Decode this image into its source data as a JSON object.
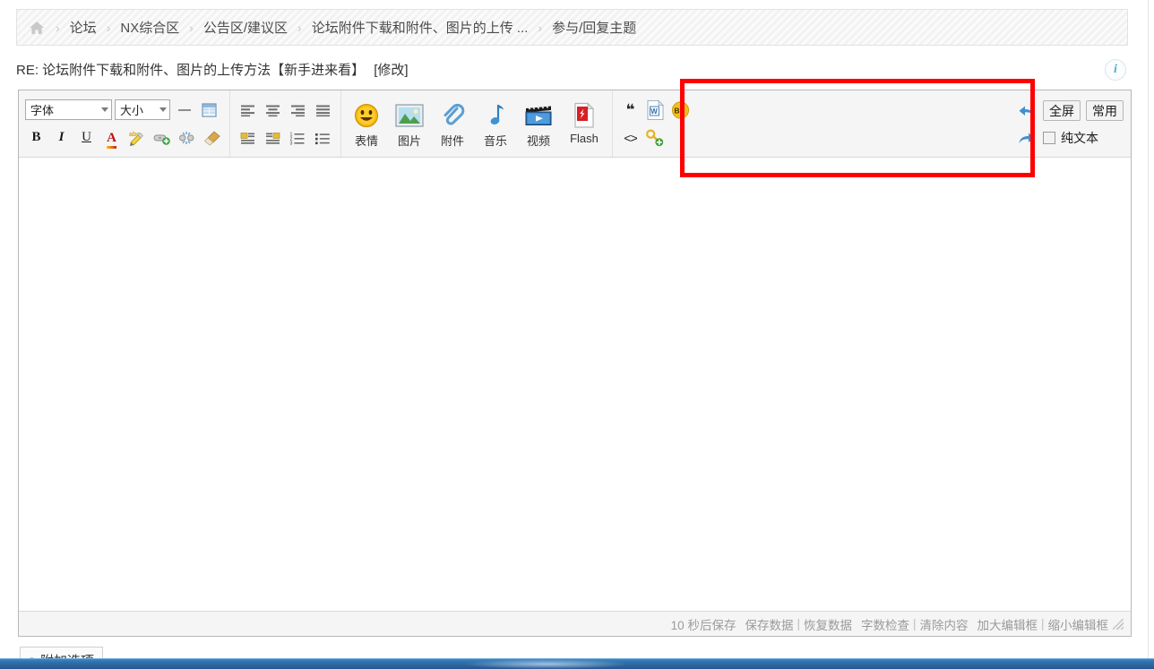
{
  "breadcrumb": {
    "home_icon": "home-icon",
    "separator": "›",
    "items": [
      {
        "label": "论坛"
      },
      {
        "label": "NX综合区"
      },
      {
        "label": "公告区/建议区"
      },
      {
        "label": "论坛附件下载和附件、图片的上传 ..."
      },
      {
        "label": "参与/回复主题"
      }
    ]
  },
  "header": {
    "title": "RE: 论坛附件下载和附件、图片的上传方法【新手进来看】",
    "edit_link": "[修改]",
    "info_icon": "info-icon",
    "info_glyph": "i"
  },
  "toolbar": {
    "font_select": {
      "value": "字体",
      "icon": "chevron-down-icon"
    },
    "size_select": {
      "value": "大小",
      "icon": "chevron-down-icon"
    },
    "row1_misc": [
      {
        "name": "horizontal-rule-button",
        "icon": "horizontal-rule-icon"
      },
      {
        "name": "insert-table-button",
        "icon": "table-icon"
      }
    ],
    "format_buttons": [
      {
        "name": "bold-button",
        "glyph": "B",
        "icon": "bold-icon"
      },
      {
        "name": "italic-button",
        "glyph": "I",
        "icon": "italic-icon"
      },
      {
        "name": "underline-button",
        "glyph": "U",
        "icon": "underline-icon"
      },
      {
        "name": "text-color-button",
        "glyph": "A",
        "icon": "text-color-icon"
      },
      {
        "name": "spellcheck-button",
        "glyph": "abc",
        "icon": "spellcheck-icon"
      },
      {
        "name": "insert-link-button",
        "glyph": "",
        "icon": "link-add-icon"
      },
      {
        "name": "remove-link-button",
        "glyph": "",
        "icon": "link-break-icon"
      },
      {
        "name": "clear-format-button",
        "glyph": "",
        "icon": "broom-icon"
      }
    ],
    "align_buttons": [
      {
        "name": "align-left-button",
        "icon": "align-left-icon"
      },
      {
        "name": "align-center-button",
        "icon": "align-center-icon"
      },
      {
        "name": "align-right-button",
        "icon": "align-right-icon"
      },
      {
        "name": "align-justify-button",
        "icon": "align-justify-icon"
      },
      {
        "name": "float-left-button",
        "icon": "image-float-left-icon"
      },
      {
        "name": "float-right-button",
        "icon": "image-float-right-icon"
      },
      {
        "name": "ordered-list-button",
        "icon": "ordered-list-icon"
      },
      {
        "name": "unordered-list-button",
        "icon": "unordered-list-icon"
      }
    ],
    "media_buttons": [
      {
        "label": "表情",
        "icon": "smiley-icon",
        "name": "emoji-button"
      },
      {
        "label": "图片",
        "icon": "image-icon",
        "name": "image-button"
      },
      {
        "label": "附件",
        "icon": "paperclip-icon",
        "name": "attachment-button"
      },
      {
        "label": "音乐",
        "icon": "music-note-icon",
        "name": "music-button"
      },
      {
        "label": "视频",
        "icon": "clapperboard-icon",
        "name": "video-button"
      },
      {
        "label": "Flash",
        "icon": "flash-file-icon",
        "name": "flash-button"
      }
    ],
    "extra_buttons": [
      {
        "name": "quote-button",
        "glyph": "❝",
        "icon": "quote-icon"
      },
      {
        "name": "paste-from-word-button",
        "glyph": "W",
        "icon": "word-document-icon"
      },
      {
        "name": "background-color-button",
        "glyph": "Bg",
        "icon": "background-color-icon"
      },
      {
        "name": "source-code-button",
        "glyph": "<>",
        "icon": "code-icon"
      },
      {
        "name": "password-protect-button",
        "glyph": "",
        "icon": "key-add-icon"
      }
    ],
    "right_controls": {
      "undo": {
        "name": "undo-button",
        "icon": "undo-arrow-icon"
      },
      "redo": {
        "name": "redo-button",
        "icon": "redo-arrow-icon"
      },
      "fullscreen_label": "全屏",
      "common_label": "常用",
      "plaintext_label": "纯文本",
      "plaintext_checked": false
    }
  },
  "editor": {
    "content": "",
    "placeholder": ""
  },
  "status_bar": {
    "autosave_text": "10 秒后保存",
    "save_data": "保存数据",
    "restore_data": "恢复数据",
    "word_count": "字数检查",
    "clear_content": "清除内容",
    "enlarge_editor": "加大编辑框",
    "shrink_editor": "缩小编辑框",
    "separator": "|",
    "grip_icon": "resize-grip-icon"
  },
  "extra_options": {
    "label": "附加选项",
    "bullet_icon": "bullet-dot-icon"
  },
  "annotation": {
    "name": "red-highlight-box",
    "color": "#fe0000",
    "border_width": 5
  },
  "colors": {
    "accent": "#fe0000",
    "toolbar_bg": "#f5f5f5",
    "page_bg": "#ffffff",
    "taskbar": "#2f6eab",
    "muted_text": "#9b9b9b"
  }
}
